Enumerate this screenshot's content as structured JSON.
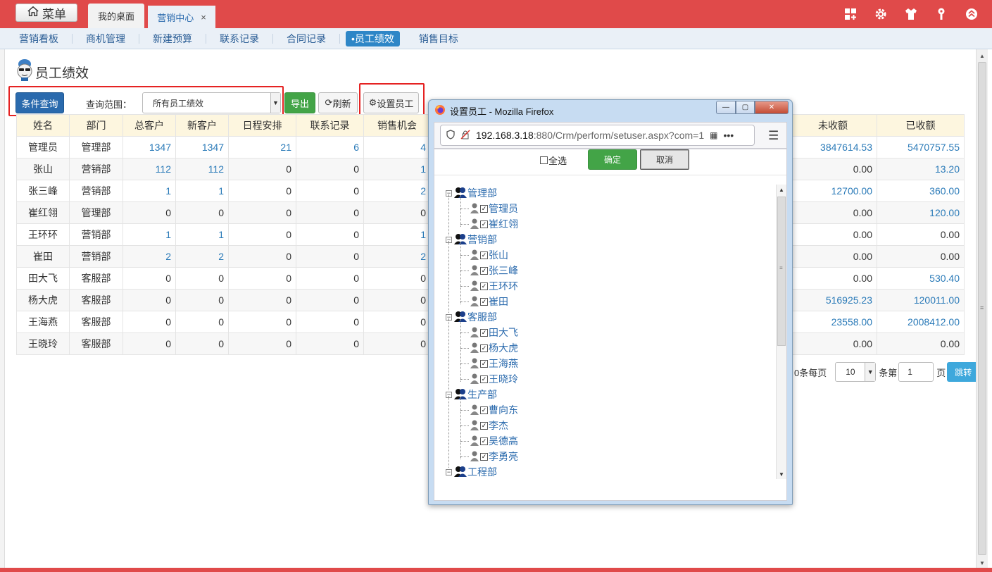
{
  "topbar": {
    "menu_label": "菜单",
    "tabs": [
      {
        "label": "我的桌面"
      },
      {
        "label": "营销中心",
        "close": "×"
      }
    ]
  },
  "subnav": [
    {
      "label": "营销看板"
    },
    {
      "label": "商机管理"
    },
    {
      "label": "新建预算"
    },
    {
      "label": "联系记录"
    },
    {
      "label": "合同记录"
    },
    {
      "label": "•员工绩效",
      "active": true
    },
    {
      "label": "销售目标"
    }
  ],
  "page": {
    "title": "员工绩效"
  },
  "toolbar": {
    "query_label": "条件查询",
    "scope_label": "查询范围：",
    "scope_value": "所有员工绩效",
    "export_label": "导出",
    "refresh_label": "刷新",
    "set_staff_label": "设置员工"
  },
  "table": {
    "headers": [
      "姓名",
      "部门",
      "总客户",
      "新客户",
      "日程安排",
      "联系记录",
      "销售机会"
    ],
    "right_headers": [
      "未收额",
      "已收额"
    ],
    "rows": [
      {
        "name": "管理员",
        "dept": "管理部",
        "total": "1347",
        "new": "1347",
        "schedule": "21",
        "contact": "6",
        "opp": "4",
        "unpaid": "3847614.53",
        "paid": "5470757.55"
      },
      {
        "name": "张山",
        "dept": "营销部",
        "total": "112",
        "new": "112",
        "schedule": "0",
        "contact": "0",
        "opp": "1",
        "unpaid": "0.00",
        "paid": "13.20"
      },
      {
        "name": "张三峰",
        "dept": "营销部",
        "total": "1",
        "new": "1",
        "schedule": "0",
        "contact": "0",
        "opp": "2",
        "unpaid": "12700.00",
        "paid": "360.00"
      },
      {
        "name": "崔红翎",
        "dept": "管理部",
        "total": "0",
        "new": "0",
        "schedule": "0",
        "contact": "0",
        "opp": "0",
        "unpaid": "0.00",
        "paid": "120.00"
      },
      {
        "name": "王环环",
        "dept": "营销部",
        "total": "1",
        "new": "1",
        "schedule": "0",
        "contact": "0",
        "opp": "1",
        "unpaid": "0.00",
        "paid": "0.00"
      },
      {
        "name": "崔田",
        "dept": "营销部",
        "total": "2",
        "new": "2",
        "schedule": "0",
        "contact": "0",
        "opp": "2",
        "unpaid": "0.00",
        "paid": "0.00"
      },
      {
        "name": "田大飞",
        "dept": "客服部",
        "total": "0",
        "new": "0",
        "schedule": "0",
        "contact": "0",
        "opp": "0",
        "unpaid": "0.00",
        "paid": "530.40"
      },
      {
        "name": "杨大虎",
        "dept": "客服部",
        "total": "0",
        "new": "0",
        "schedule": "0",
        "contact": "0",
        "opp": "0",
        "unpaid": "516925.23",
        "paid": "120011.00"
      },
      {
        "name": "王海燕",
        "dept": "客服部",
        "total": "0",
        "new": "0",
        "schedule": "0",
        "contact": "0",
        "opp": "0",
        "unpaid": "23558.00",
        "paid": "2008412.00"
      },
      {
        "name": "王晓玲",
        "dept": "客服部",
        "total": "0",
        "new": "0",
        "schedule": "0",
        "contact": "0",
        "opp": "0",
        "unpaid": "0.00",
        "paid": "0.00"
      }
    ]
  },
  "pager": {
    "per_page_prefix": "0条每页",
    "per_page": "10",
    "page_prefix": "条第",
    "page": "1",
    "page_suffix": "页",
    "go_label": "跳转"
  },
  "popup": {
    "title": "设置员工 - Mozilla Firefox",
    "url_host": "192.168.3.18",
    "url_path": ":880/Crm/perform/setuser.aspx?com=1",
    "select_all_label": "全选",
    "ok_label": "确定",
    "cancel_label": "取消",
    "tree": [
      {
        "dept": "管理部",
        "users": [
          "管理员",
          "崔红翎"
        ]
      },
      {
        "dept": "营销部",
        "users": [
          "张山",
          "张三峰",
          "王环环",
          "崔田"
        ]
      },
      {
        "dept": "客服部",
        "users": [
          "田大飞",
          "杨大虎",
          "王海燕",
          "王晓玲"
        ]
      },
      {
        "dept": "生产部",
        "users": [
          "曹向东",
          "李杰",
          "吴德高",
          "李勇亮"
        ]
      },
      {
        "dept": "工程部",
        "users": []
      }
    ]
  },
  "colors": {
    "brand_red": "#e04a4a",
    "link_blue": "#2a7ab8",
    "primary_blue": "#2a6aad",
    "success_green": "#43a447",
    "header_yellow": "#fdf6df",
    "highlight_red": "#e52222"
  }
}
